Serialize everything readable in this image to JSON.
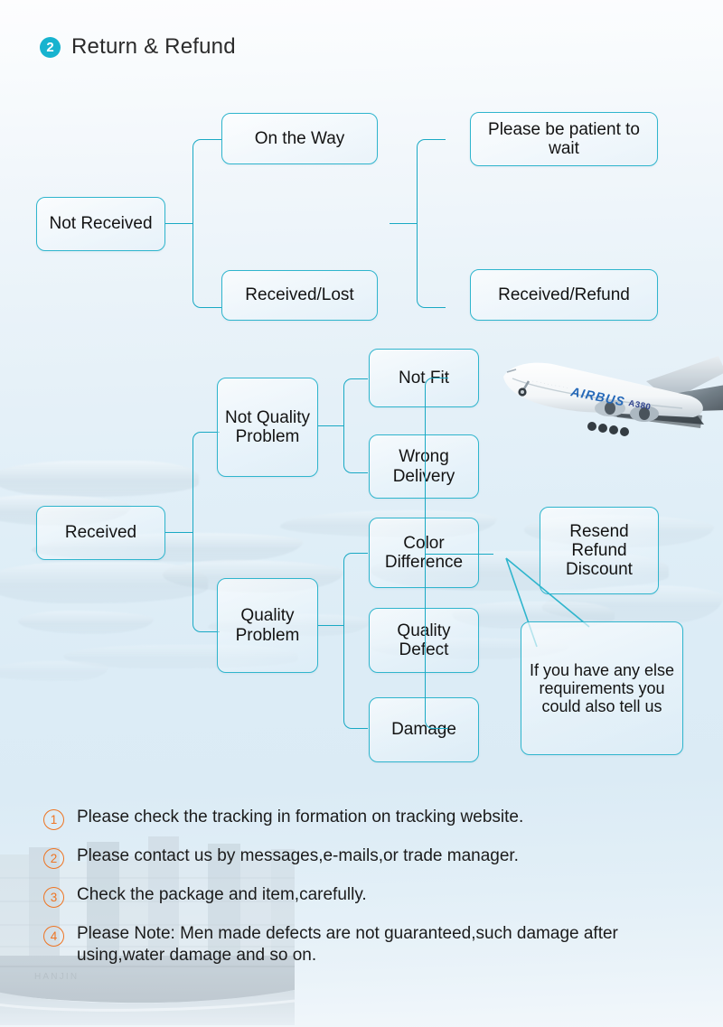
{
  "header": {
    "badge": "2",
    "title": "Return & Refund",
    "badge_color": "#17b3cf"
  },
  "theme": {
    "node_border": "#2fb5cd",
    "connector": "#19a9c4",
    "note_number": "#ee7422",
    "text": "#131313"
  },
  "images": {
    "plane_label": "airbus-a380-photo",
    "plane_wordmark": "AIRBUS",
    "plane_model": "A380",
    "ship_label": "container-ship-photo",
    "map_label": "world-map-relief"
  },
  "flow": {
    "tree_not_received": {
      "root": "Not Received",
      "children": [
        {
          "label": "On the Way",
          "outcome": "Please be patient to wait"
        },
        {
          "label": "Received/Lost",
          "outcome": "Received/Refund"
        }
      ]
    },
    "tree_received": {
      "root": "Received",
      "branches": [
        {
          "label": "Not Quality Problem",
          "children": [
            "Not Fit",
            "Wrong Delivery"
          ]
        },
        {
          "label": "Quality Problem",
          "children": [
            "Color Difference",
            "Quality Defect",
            "Damage"
          ]
        }
      ],
      "outcome": "Resend Refund Discount",
      "callout": "If you have any else requirements you could also tell us"
    }
  },
  "notes": [
    {
      "num": "1",
      "text": "Please check the tracking in formation on tracking website."
    },
    {
      "num": "2",
      "text": "Please contact us by messages,e-mails,or trade manager."
    },
    {
      "num": "3",
      "text": "Check the package and item,carefully."
    },
    {
      "num": "4",
      "text": "Please Note: Men made defects are not guaranteed,such damage after using,water damage and so on."
    }
  ]
}
